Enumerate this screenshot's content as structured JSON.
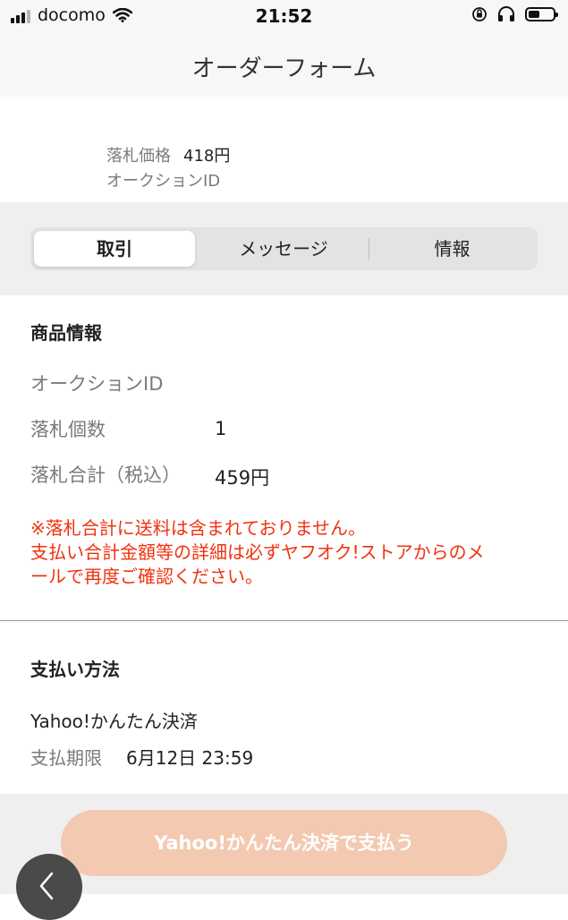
{
  "status_bar": {
    "carrier": "docomo",
    "time": "21:52"
  },
  "navbar": {
    "title": "オーダーフォーム"
  },
  "summary": {
    "price_label": "落札価格",
    "price_value": "418円",
    "auction_id_label": "オークションID"
  },
  "tabs": [
    {
      "label": "取引",
      "active": true
    },
    {
      "label": "メッセージ",
      "active": false
    },
    {
      "label": "情報",
      "active": false
    }
  ],
  "product_info": {
    "title": "商品情報",
    "auction_id_label": "オークションID",
    "quantity_label": "落札個数",
    "quantity_value": "1",
    "total_label": "落札合計（税込）",
    "total_value": "459円",
    "notice_line1": "※落札合計に送料は含まれておりません。",
    "notice_line2": "支払い合計金額等の詳細は必ずヤフオク!ストアからのメ",
    "notice_line3": "ールで再度ご確認ください。"
  },
  "payment": {
    "title": "支払い方法",
    "method": "Yahoo!かんたん決済",
    "deadline_label": "支払期限",
    "deadline_value": "6月12日 23:59"
  },
  "bottom": {
    "pay_button": "Yahoo!かんたん決済で支払う"
  },
  "colors": {
    "notice": "#f0320f",
    "pay_button": "#f4c9b1"
  }
}
